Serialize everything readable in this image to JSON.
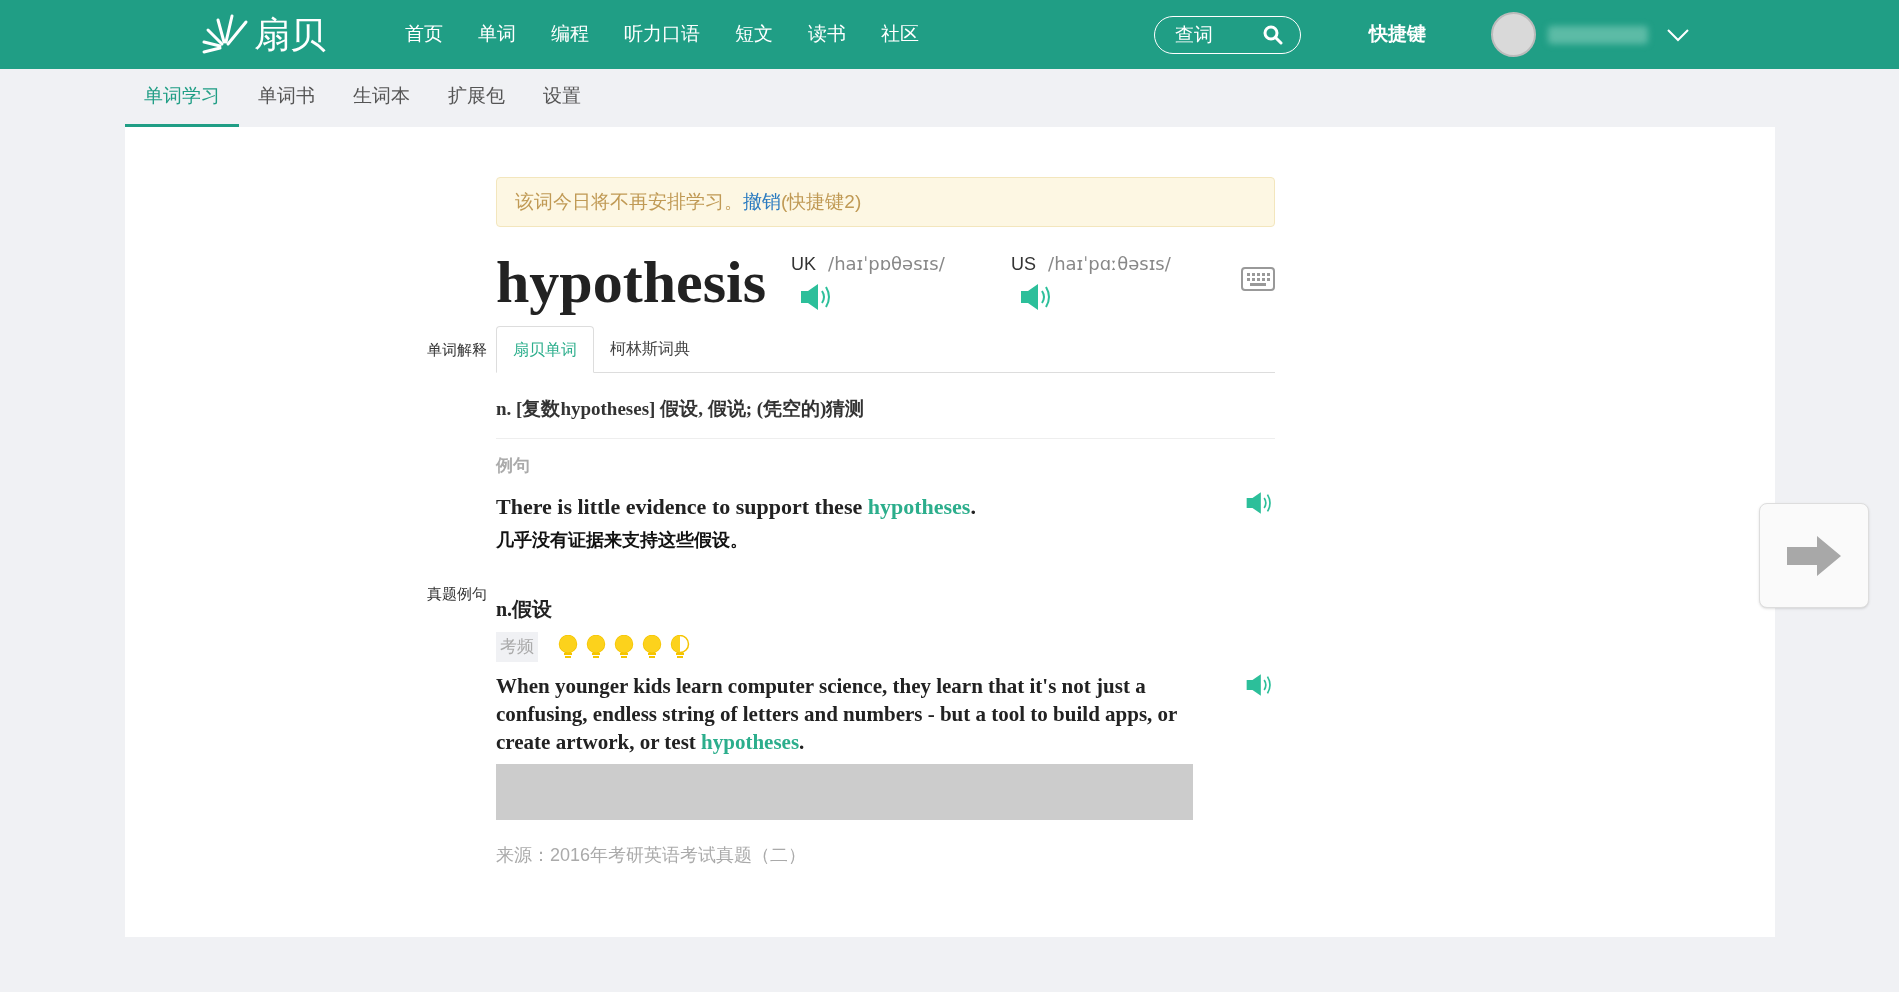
{
  "header": {
    "logo": "扇贝",
    "nav": [
      {
        "label": "首页"
      },
      {
        "label": "单词"
      },
      {
        "label": "编程"
      },
      {
        "label": "听力口语"
      },
      {
        "label": "短文"
      },
      {
        "label": "读书"
      },
      {
        "label": "社区"
      }
    ],
    "search": {
      "placeholder": "查词"
    },
    "shortcuts": "快捷键"
  },
  "subnav": [
    {
      "label": "单词学习",
      "selected": true
    },
    {
      "label": "单词书",
      "selected": false
    },
    {
      "label": "生词本",
      "selected": false
    },
    {
      "label": "扩展包",
      "selected": false
    },
    {
      "label": "设置",
      "selected": false
    }
  ],
  "notice": {
    "text": "该词今日将不再安排学习。",
    "link": "撤销",
    "hint": "(快捷键2)"
  },
  "word": "hypothesis",
  "pronunciations": [
    {
      "region": "UK",
      "ipa": "/haɪˈpɒθəsɪs/"
    },
    {
      "region": "US",
      "ipa": "/haɪˈpɑːθəsɪs/"
    }
  ],
  "definition_label": "单词解释",
  "definition_tabs": [
    {
      "label": "扇贝单词",
      "selected": true
    },
    {
      "label": "柯林斯词典",
      "selected": false
    }
  ],
  "definition": "n. [复数hypotheses] 假设, 假说; (凭空的)猜测",
  "example_heading": "例句",
  "example": {
    "sentence": "There is little evidence to support these **hypotheses**.",
    "translation": "几乎没有证据来支持这些假设。"
  },
  "exam_label": "真题例句",
  "exam": {
    "sense": "n.假设",
    "frequency_label": "考频",
    "stars": 4.5,
    "sentence": "When younger kids learn computer science, they learn that it's not just a confusing, endless string of letters and numbers - but a tool to build apps, or create artwork, or test **hypotheses**.",
    "source": "来源：2016年考研英语考试真题（二）"
  }
}
